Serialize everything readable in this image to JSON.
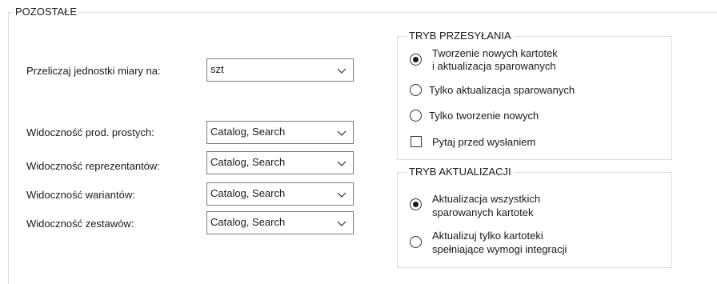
{
  "pozostale": {
    "title": "POZOSTAŁE",
    "rows": [
      {
        "label": "Przeliczaj jednostki miary na:",
        "value": "szt"
      },
      {
        "label": "Widoczność prod. prostych:",
        "value": "Catalog, Search"
      },
      {
        "label": "Widoczność reprezentantów:",
        "value": "Catalog, Search"
      },
      {
        "label": "Widoczność wariantów:",
        "value": "Catalog, Search"
      },
      {
        "label": "Widoczność zestawów:",
        "value": "Catalog, Search"
      }
    ]
  },
  "tryb_przesylania": {
    "title": "TRYB PRZESYŁANIA",
    "options": [
      {
        "line1": "Tworzenie nowych kartotek",
        "line2": "i aktualizacja sparowanych",
        "selected": true
      },
      {
        "line1": "Tylko aktualizacja sparowanych",
        "line2": "",
        "selected": false
      },
      {
        "line1": "Tylko tworzenie nowych",
        "line2": "",
        "selected": false
      }
    ],
    "confirm_checkbox": {
      "label": "Pytaj przed wysłaniem",
      "checked": false
    }
  },
  "tryb_aktualizacji": {
    "title": "TRYB AKTUALIZACJI",
    "options": [
      {
        "line1": "Aktualizacja wszystkich",
        "line2": "sparowanych kartotek",
        "selected": true
      },
      {
        "line1": "Aktualizuj tylko kartoteki",
        "line2": "spełniające wymogi integracji",
        "selected": false
      }
    ]
  }
}
